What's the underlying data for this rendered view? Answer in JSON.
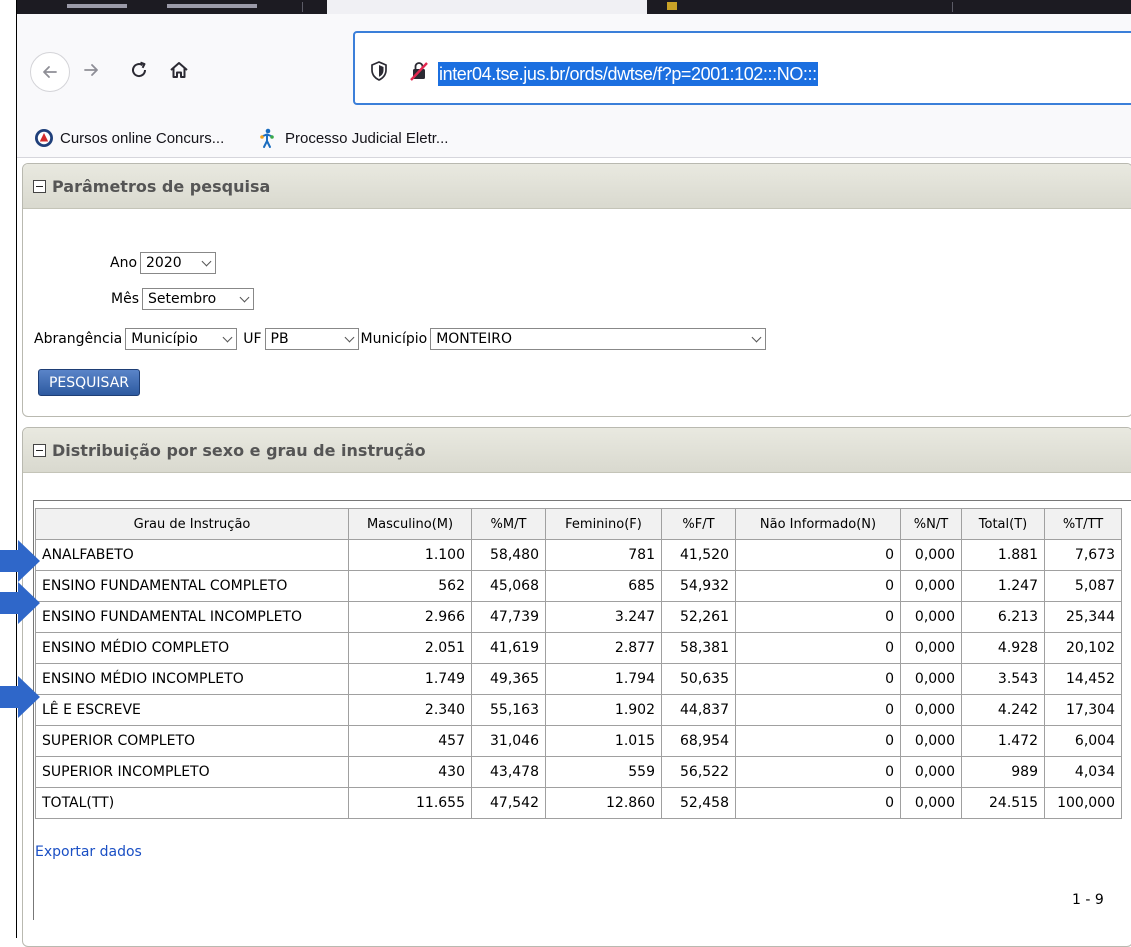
{
  "browser": {
    "url": "inter04.tse.jus.br/ords/dwtse/f?p=2001:102:::NO:::",
    "bookmarks": [
      {
        "label": "Cursos online Concurs...",
        "icon": "concursos-icon"
      },
      {
        "label": "Processo Judicial Eletr...",
        "icon": "pje-icon"
      }
    ]
  },
  "search_params": {
    "title": "Parâmetros de pesquisa",
    "ano_label": "Ano",
    "ano_value": "2020",
    "mes_label": "Mês",
    "mes_value": "Setembro",
    "abrangencia_label": "Abrangência",
    "abrangencia_value": "Município",
    "uf_label": "UF",
    "uf_value": "PB",
    "municipio_label": "Município",
    "municipio_value": "MONTEIRO",
    "search_button": "PESQUISAR"
  },
  "report": {
    "title": "Distribuição por sexo e grau de instrução",
    "columns": [
      "Grau de Instrução",
      "Masculino(M)",
      "%M/T",
      "Feminino(F)",
      "%F/T",
      "Não Informado(N)",
      "%N/T",
      "Total(T)",
      "%T/TT"
    ],
    "rows": [
      [
        "ANALFABETO",
        "1.100",
        "58,480",
        "781",
        "41,520",
        "0",
        "0,000",
        "1.881",
        "7,673"
      ],
      [
        "ENSINO FUNDAMENTAL COMPLETO",
        "562",
        "45,068",
        "685",
        "54,932",
        "0",
        "0,000",
        "1.247",
        "5,087"
      ],
      [
        "ENSINO FUNDAMENTAL INCOMPLETO",
        "2.966",
        "47,739",
        "3.247",
        "52,261",
        "0",
        "0,000",
        "6.213",
        "25,344"
      ],
      [
        "ENSINO MÉDIO COMPLETO",
        "2.051",
        "41,619",
        "2.877",
        "58,381",
        "0",
        "0,000",
        "4.928",
        "20,102"
      ],
      [
        "ENSINO MÉDIO INCOMPLETO",
        "1.749",
        "49,365",
        "1.794",
        "50,635",
        "0",
        "0,000",
        "3.543",
        "14,452"
      ],
      [
        "LÊ E ESCREVE",
        "2.340",
        "55,163",
        "1.902",
        "44,837",
        "0",
        "0,000",
        "4.242",
        "17,304"
      ],
      [
        "SUPERIOR COMPLETO",
        "457",
        "31,046",
        "1.015",
        "68,954",
        "0",
        "0,000",
        "1.472",
        "6,004"
      ],
      [
        "SUPERIOR INCOMPLETO",
        "430",
        "43,478",
        "559",
        "56,522",
        "0",
        "0,000",
        "989",
        "4,034"
      ],
      [
        "TOTAL(TT)",
        "11.655",
        "47,542",
        "12.860",
        "52,458",
        "0",
        "0,000",
        "24.515",
        "100,000"
      ]
    ],
    "export_link": "Exportar dados",
    "pagination": "1 - 9"
  },
  "colors": {
    "url_highlight": "#1b6fe0",
    "annotation_arrow": "#2f67c9",
    "button": "#3a66ad"
  }
}
